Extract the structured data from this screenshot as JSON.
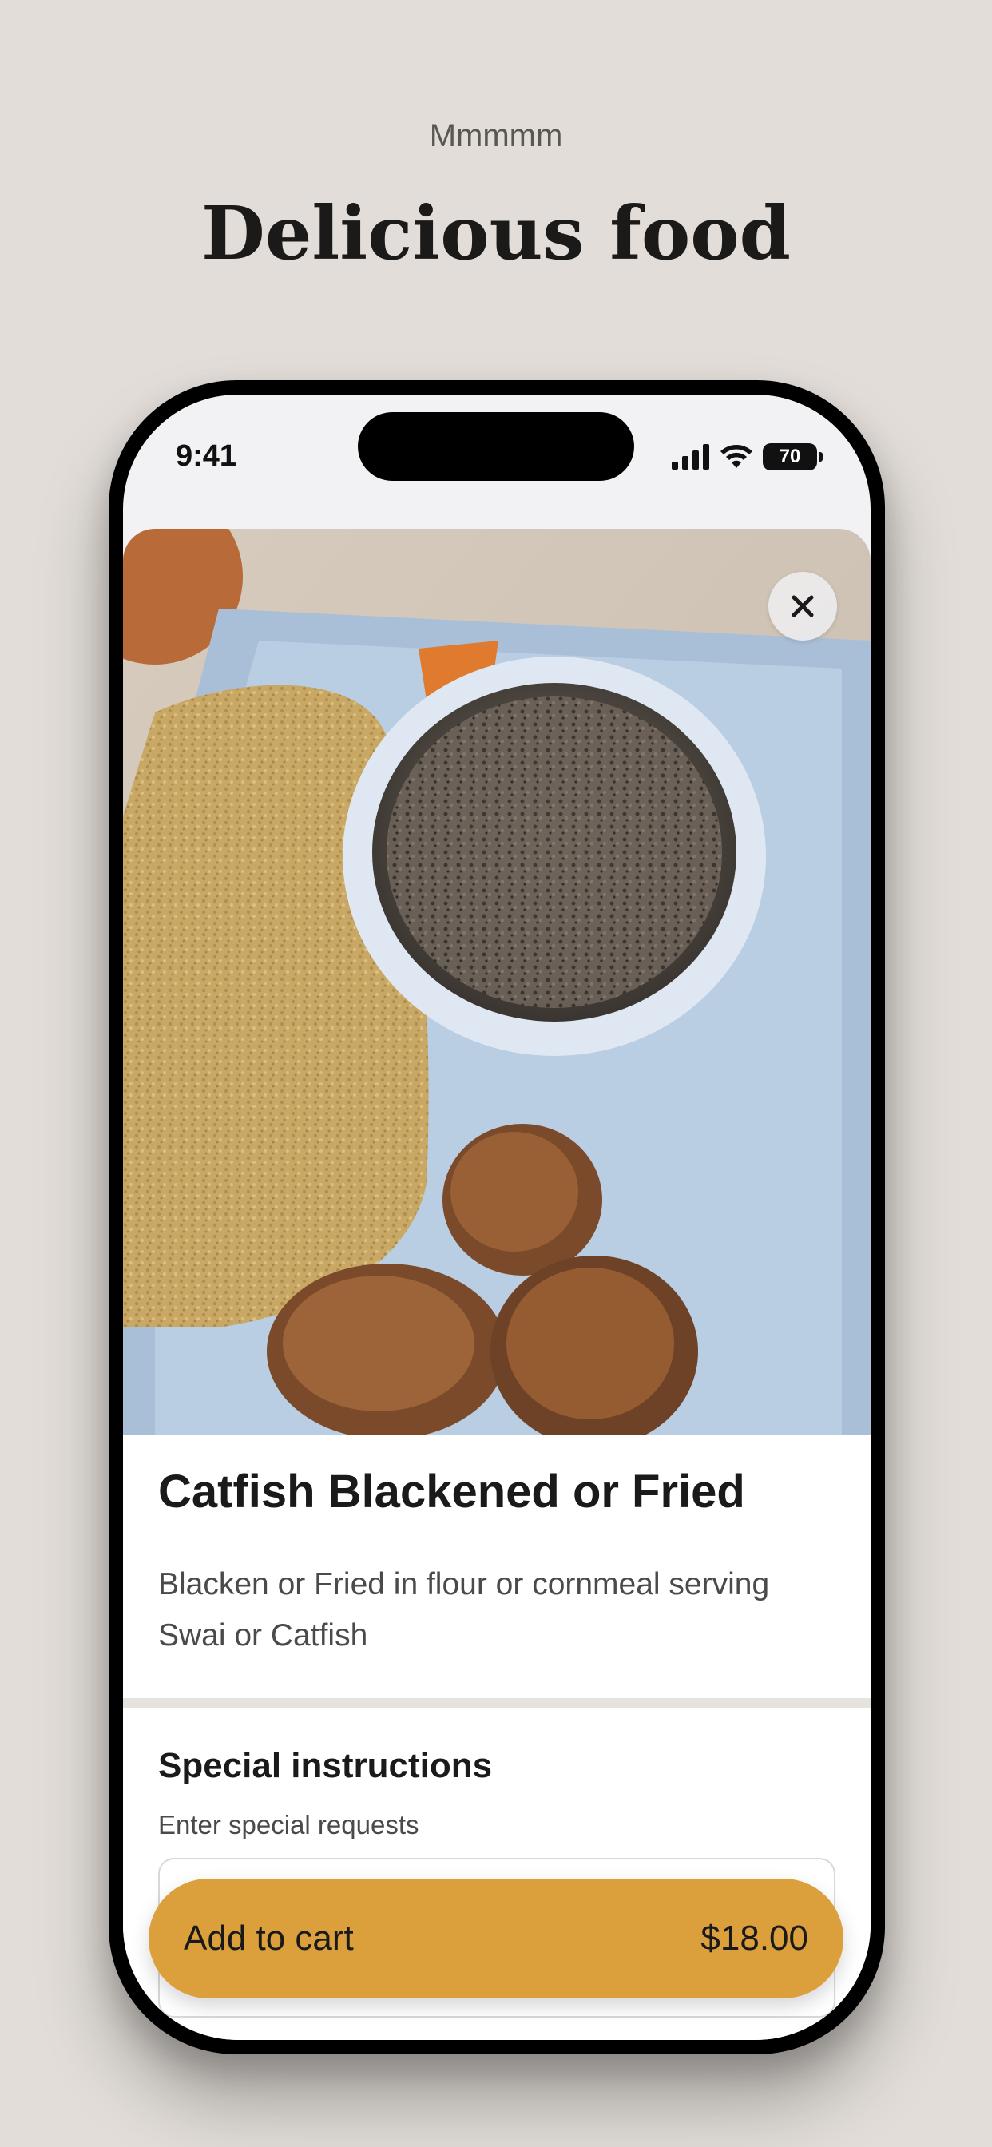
{
  "page": {
    "eyebrow": "Mmmmm",
    "headline": "Delicious food"
  },
  "statusbar": {
    "time": "9:41",
    "battery": "70",
    "icons": [
      "cellular-signal-icon",
      "wifi-icon",
      "battery-icon"
    ]
  },
  "item": {
    "photo": "catfish-plate-photo",
    "title": "Catfish Blackened or Fried",
    "description": "Blacken or Fried in flour or cornmeal serving Swai or Catfish",
    "close_icon": "close-icon"
  },
  "instructions": {
    "title": "Special instructions",
    "subtitle": "Enter special requests",
    "value": ""
  },
  "cart": {
    "label": "Add to cart",
    "price": "$18.00"
  },
  "colors": {
    "background": "#e2ddd8",
    "accent": "#dba03c",
    "text": "#1a1a1a"
  }
}
